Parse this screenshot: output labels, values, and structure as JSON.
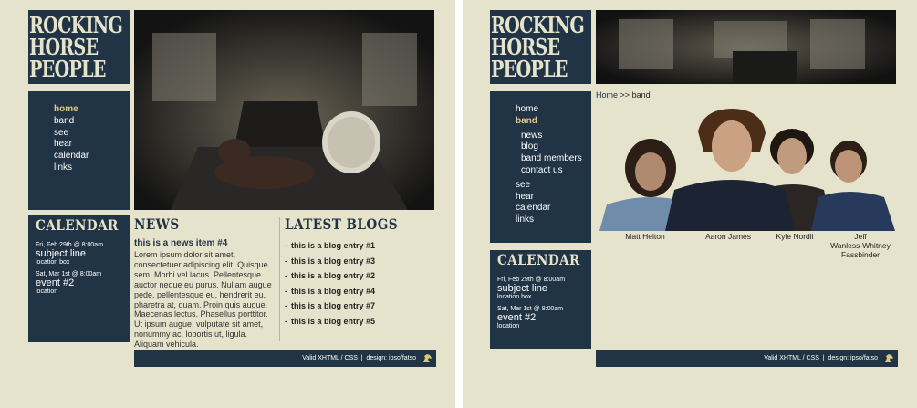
{
  "site": {
    "logo_lines": [
      "ROCKING",
      "HORSE",
      "PEOPLE"
    ]
  },
  "left_page": {
    "nav": [
      "home",
      "band",
      "see",
      "hear",
      "calendar",
      "links"
    ],
    "active_nav": "home",
    "calendar": {
      "heading": "CALENDAR",
      "events": [
        {
          "date": "Fri, Feb 29th @ 8:00am",
          "title": "subject line",
          "location": "location box"
        },
        {
          "date": "Sat, Mar 1st @ 8:00am",
          "title": "event #2",
          "location": "location"
        }
      ]
    },
    "news": {
      "heading": "NEWS",
      "item_title": "this is a news item #4",
      "body": "Lorem ipsum dolor sit amet, consectetuer adipiscing elit. Quisque sem. Morbi vel lacus. Pellentesque auctor neque eu purus. Nullam augue pede, pellentesque eu, hendrerit eu, pharetra at, quam. Proin quis augue. Maecenas lectus. Phasellus porttitor. Ut ipsum augue, vulputate sit amet, nonummy ac, lobortis ut, ligula. Aliquam vehicula."
    },
    "blogs": {
      "heading": "LATEST BLOGS",
      "entries": [
        "this is a blog entry #1",
        "this is a blog entry #3",
        "this is a blog entry #2",
        "this is a blog entry #4",
        "this is a blog entry #7",
        "this is a blog entry #5"
      ]
    },
    "footer": "Valid XHTML / CSS  |  design: ipso/fatso"
  },
  "right_page": {
    "nav": [
      "home",
      "band"
    ],
    "sub_nav": [
      "news",
      "blog",
      "band members",
      "contact us"
    ],
    "nav_after": [
      "see",
      "hear",
      "calendar",
      "links"
    ],
    "active_nav": "band",
    "breadcrumb": {
      "home": "Home",
      "sep": ">>",
      "current": "band"
    },
    "members": [
      {
        "name": "Matt Helton"
      },
      {
        "name": "Aaron James"
      },
      {
        "name": "Kyle Nordli"
      },
      {
        "name_lines": [
          "Jeff",
          "Wanless-Whitney",
          "Fassbinder"
        ]
      }
    ],
    "calendar": {
      "heading": "CALENDAR",
      "events": [
        {
          "date": "Fri, Feb 29th @ 8:00am",
          "title": "subject line",
          "location": "location box"
        },
        {
          "date": "Sat, Mar 1st @ 8:00am",
          "title": "event #2",
          "location": "location"
        }
      ]
    },
    "footer": "Valid XHTML / CSS  |  design: ipso/fatso"
  },
  "colors": {
    "navy": "#213445",
    "cream": "#e6e3cc",
    "accent": "#e0c987"
  },
  "icons": [
    "horse-icon"
  ]
}
